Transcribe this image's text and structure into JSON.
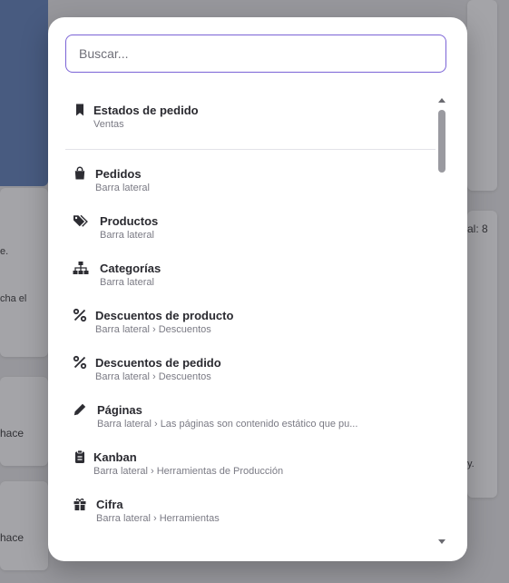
{
  "background": {
    "fragments": [
      "e.",
      "cha el",
      "al: 8",
      "hace",
      "hace",
      "y."
    ]
  },
  "search": {
    "placeholder": "Buscar...",
    "value": ""
  },
  "results": [
    {
      "icon": "bookmark-icon",
      "title": "Estados de pedido",
      "subtitle": "Ventas"
    },
    {
      "icon": "shopping-bag-icon",
      "title": "Pedidos",
      "subtitle": "Barra lateral"
    },
    {
      "icon": "tags-icon",
      "title": "Productos",
      "subtitle": "Barra lateral"
    },
    {
      "icon": "sitemap-icon",
      "title": "Categorías",
      "subtitle": "Barra lateral"
    },
    {
      "icon": "percent-icon",
      "title": "Descuentos de producto",
      "subtitle": "Barra lateral › Descuentos"
    },
    {
      "icon": "percent-icon",
      "title": "Descuentos de pedido",
      "subtitle": "Barra lateral › Descuentos"
    },
    {
      "icon": "pencil-icon",
      "title": "Páginas",
      "subtitle": "Barra lateral › Las páginas son contenido estático que pu..."
    },
    {
      "icon": "clipboard-icon",
      "title": "Kanban",
      "subtitle": "Barra lateral › Herramientas de Producción"
    },
    {
      "icon": "gift-icon",
      "title": "Cifra",
      "subtitle": "Barra lateral › Herramientas"
    }
  ],
  "colors": {
    "accent": "#7b63d6",
    "highlight": "#f1eefb"
  }
}
